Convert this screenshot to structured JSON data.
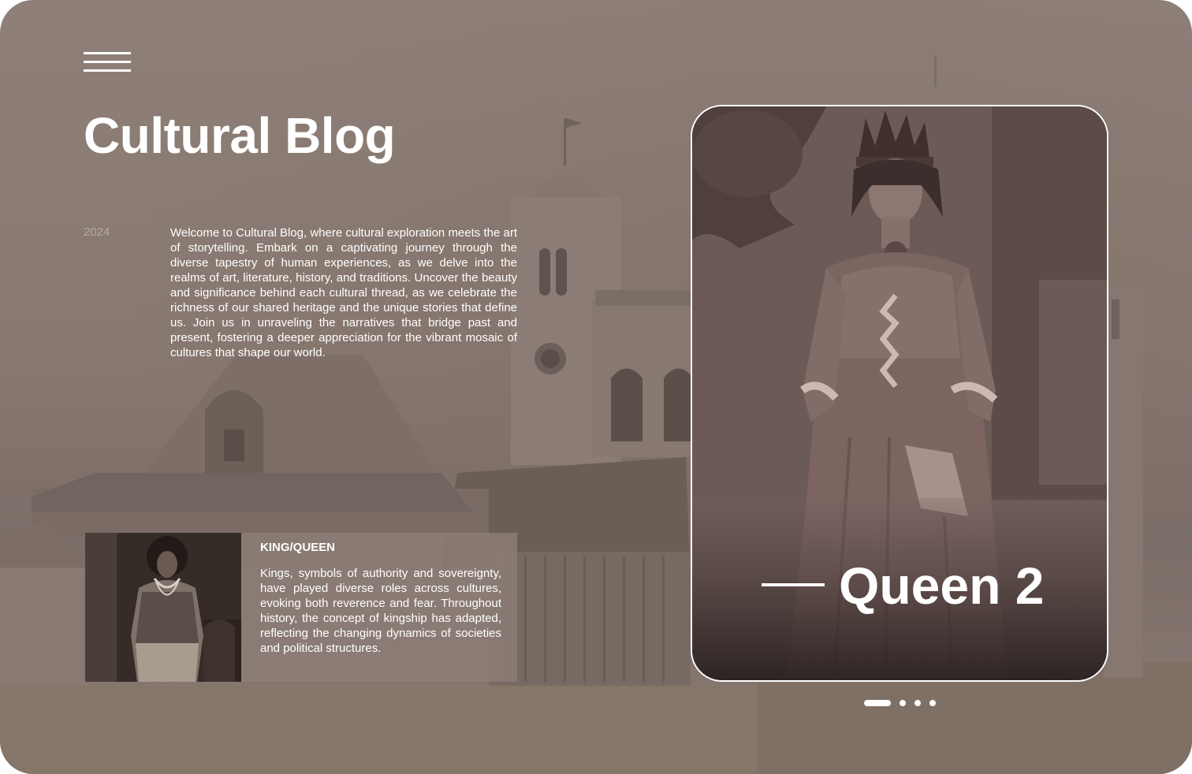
{
  "header": {
    "menu_icon": "hamburger-menu-icon",
    "title": "Cultural Blog"
  },
  "intro": {
    "year": "2024",
    "text": "Welcome to Cultural Blog, where cultural exploration meets the art of storytelling. Embark on a captivating journey through the diverse tapestry of human experiences, as we delve into the realms of art, literature, history, and traditions. Uncover the beauty and significance behind each cultural thread, as we celebrate the richness of our shared heritage and the unique stories that define us. Join us in unraveling the narratives that bridge past and present, fostering a deeper appreciation for the vibrant mosaic of cultures that shape our world."
  },
  "feature": {
    "label": "KING/QUEEN",
    "text": "Kings, symbols of authority and sovereignty, have played diverse roles across cultures, evoking both reverence and fear. Throughout history, the concept of kingship has adapted, reflecting the changing dynamics of societies and political structures."
  },
  "slider": {
    "caption": "Queen 2",
    "slide_count": 4,
    "active_index": 0
  },
  "colors": {
    "background": "#877870",
    "text": "#ffffff",
    "muted": "#b5aaa3"
  }
}
